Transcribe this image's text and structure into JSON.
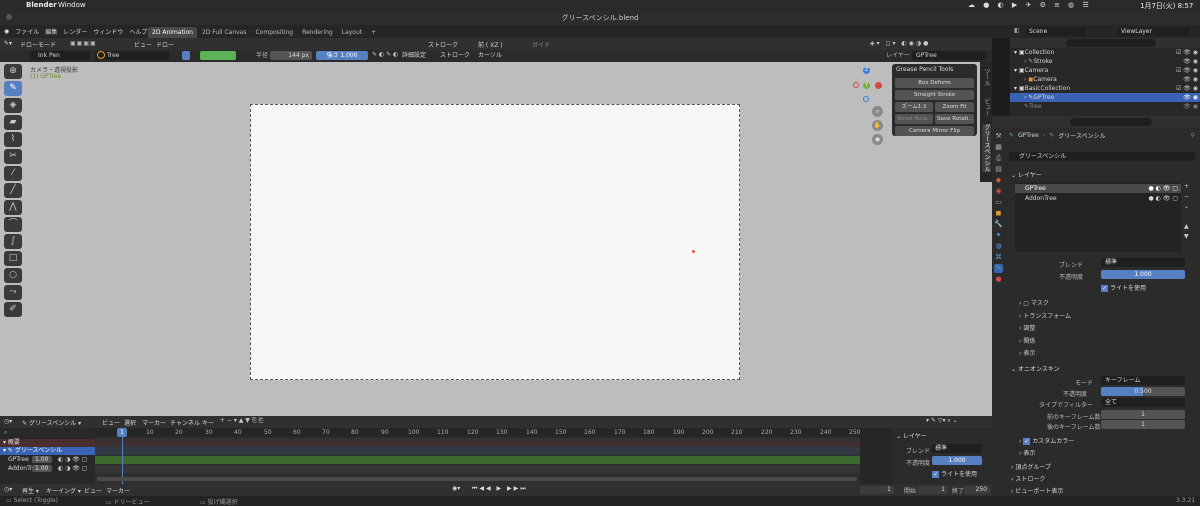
{
  "mac": {
    "app": "Blender",
    "window_menu": "Window",
    "clock": "1月7日(火) 8:57"
  },
  "title": "グリースペンシル.blend",
  "menus": [
    "ファイル",
    "編集",
    "レンダー",
    "ウィンドウ",
    "ヘルプ"
  ],
  "workspaces": [
    "2D Animation",
    "2D Full Canvas",
    "Compositing",
    "Rendering",
    "Layout"
  ],
  "scene": {
    "label": "Scene",
    "viewlayer": "ViewLayer"
  },
  "view_header": {
    "mode": "ドローモード",
    "view": "ビュー",
    "draw": "ドロー",
    "stroke_place": "ストローク",
    "axis": "前 ( XZ )",
    "guide": "ガイド",
    "layer_label": "レイヤー",
    "layer_value": "GPTree"
  },
  "tool_header": {
    "brush": "Ink Pen",
    "material": "Tree",
    "radius_label": "半径",
    "radius": "144 px",
    "strength_label": "強さ",
    "strength": "1.000",
    "advanced": "詳細設定",
    "stroke": "ストローク",
    "cursor": "カーソル"
  },
  "viewport": {
    "camera_label": "カメラ・透視投影",
    "object_label": "(1) GPTree",
    "axes": {
      "z": "Z",
      "y": "Y"
    }
  },
  "gp_tools": {
    "title": "Grease Pencil Tools",
    "box_deform": "Box Deform",
    "straight": "Straight Stroke",
    "zoom11": "ズーム1:1",
    "zoom_fit": "Zoom Fit",
    "reset_rot": "Reset Rota..",
    "save_rot": "Save Rotati..",
    "mirror": "Camera Mirror Flip"
  },
  "side_tabs": [
    "ツール",
    "ビュー",
    "グリースペンシル"
  ],
  "outliner": [
    {
      "name": "Collection",
      "indent": 1,
      "child": "Stroke"
    },
    {
      "name": "Camera",
      "indent": 1,
      "child": "Camera"
    },
    {
      "name": "BasicCollection",
      "indent": 1,
      "child": "GPTree"
    },
    {
      "name": "Tree",
      "indent": 1
    }
  ],
  "props": {
    "breadcrumb_obj": "GPTree",
    "breadcrumb_data": "グリースペンシル",
    "datablock": "グリースペンシル",
    "layers_title": "レイヤー",
    "layers": [
      "GPTree",
      "AddonTree"
    ],
    "blend_label": "ブレンド",
    "blend": "標準",
    "opacity_label": "不透明度",
    "opacity": "1.000",
    "use_lights": "ライトを使用",
    "panels": [
      "マスク",
      "トランスフォーム",
      "調整",
      "関係",
      "表示"
    ],
    "onion_title": "オニオンスキン",
    "onion_mode_label": "モード",
    "onion_mode": "キーフレーム",
    "onion_opacity_label": "不透明度",
    "onion_opacity": "0.500",
    "onion_filter_label": "タイプでフィルター",
    "onion_filter": "全て",
    "before_label": "前のキーフレーム数",
    "before": "1",
    "after_label": "後のキーフレーム数",
    "after": "1",
    "custom_colors": "カスタムカラー",
    "display": "表示",
    "sub_panels": [
      "頂点グループ",
      "ストローク",
      "ビューポート表示"
    ],
    "version": "3.3.21"
  },
  "dopesheet": {
    "mode": "グリースペンシル",
    "menus": [
      "ビュー",
      "選択",
      "マーカー",
      "チャンネル",
      "キー"
    ],
    "frame": "1",
    "ticks": [
      "10",
      "20",
      "30",
      "40",
      "50",
      "60",
      "70",
      "80",
      "90",
      "100",
      "110",
      "120",
      "130",
      "140",
      "150",
      "160",
      "170",
      "180",
      "190",
      "200",
      "210",
      "220",
      "230",
      "240",
      "250"
    ],
    "channels": {
      "summary": "概要",
      "object": "グリースペンシル",
      "layer1": "GPTree",
      "layer1_val": "1.00",
      "layer2": "AddonTree",
      "layer2_val": "1.00"
    },
    "side": {
      "title": "レイヤー",
      "blend_label": "ブレンド",
      "blend": "標準",
      "opacity_label": "不透明度",
      "opacity": "1.000",
      "lights": "ライトを使用"
    }
  },
  "playback": {
    "play": "再生",
    "keying": "キーイング",
    "view": "ビュー",
    "marker": "マーカー",
    "current": "1",
    "start_label": "開始",
    "start": "1",
    "end_label": "終了",
    "end": "250"
  },
  "status": {
    "select": "Select (Toggle)",
    "dolly": "ドリービュー",
    "lasso": "投げ縄選択",
    "version": "3.3.21"
  },
  "colors": {
    "accent": "#5680c2",
    "select": "#3b63b5",
    "green": "#5bb355"
  }
}
